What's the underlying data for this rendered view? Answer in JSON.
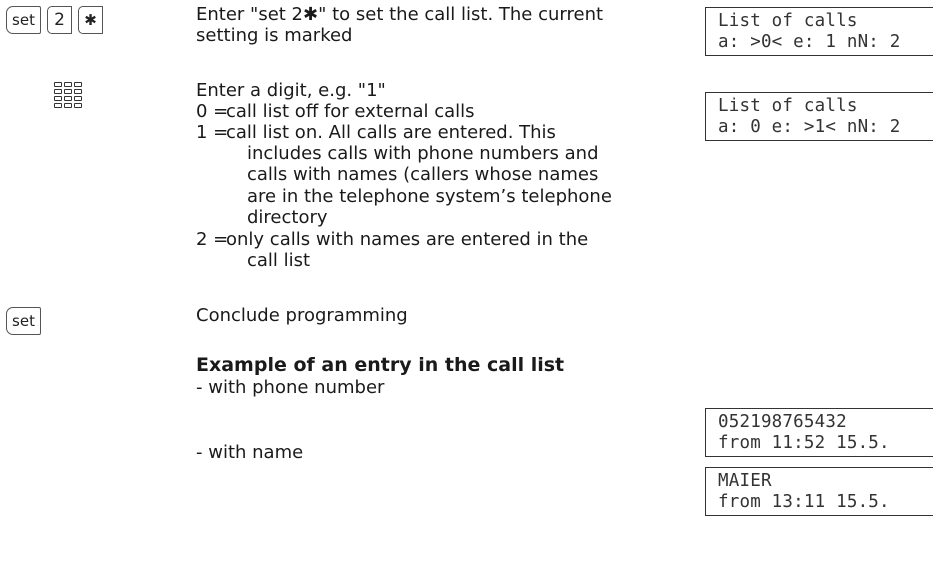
{
  "keys": {
    "set": "set",
    "digit": "2",
    "star": "✱",
    "set_conclude": "set"
  },
  "icons": {
    "keypad": "keypad-icon"
  },
  "step1": {
    "line1": "Enter \"set 2✱\" to set the call list. The current",
    "line2": "setting is marked"
  },
  "step2": {
    "intro": "Enter a digit, e.g. \"1\"",
    "options": [
      {
        "num": "0 =",
        "lines": [
          "call list off for external calls"
        ]
      },
      {
        "num": "1 =",
        "lines": [
          "call list on. All calls are entered. This",
          "includes calls with phone numbers and",
          "calls with names (callers whose names",
          "are in the telephone system’s telephone",
          "directory"
        ]
      },
      {
        "num": "2 =",
        "lines": [
          "only calls with names are entered in the",
          "call list"
        ]
      }
    ]
  },
  "step3": {
    "text": "Conclude programming"
  },
  "example": {
    "heading": "Example of an entry in the call list",
    "with_number": "- with phone number",
    "with_name": "- with name"
  },
  "displays": [
    {
      "line1": "List of calls",
      "line2": "a: >0< e: 1 nN: 2"
    },
    {
      "line1": "List of calls",
      "line2": "a: 0 e: >1< nN: 2"
    },
    {
      "line1": "052198765432",
      "line2": "from 11:52 15.5."
    },
    {
      "line1": "MAIER",
      "line2": "from 13:11 15.5."
    }
  ]
}
